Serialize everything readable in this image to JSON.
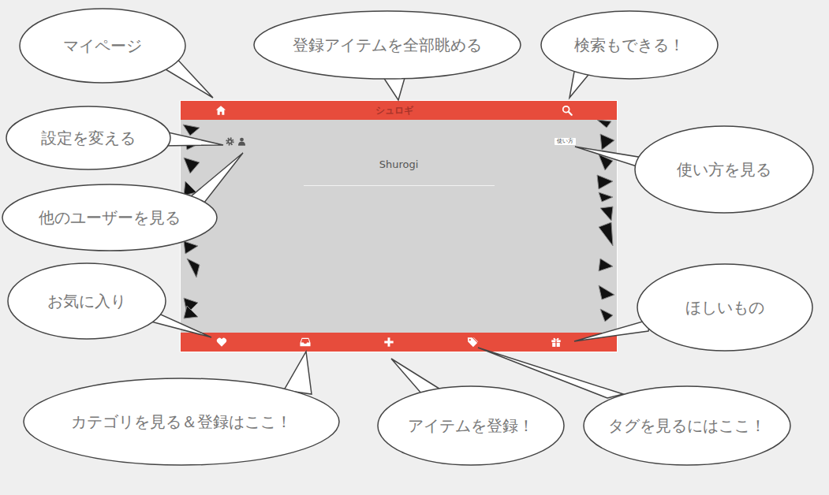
{
  "app": {
    "title": "シュロギ",
    "logo_text": "Shurogi",
    "help_button": "使い方"
  },
  "callouts": [
    {
      "text": "マイページ"
    },
    {
      "text": "登録アイテムを全部眺める"
    },
    {
      "text": "検索もできる！"
    },
    {
      "text": "設定を変える"
    },
    {
      "text": "他のユーザーを見る"
    },
    {
      "text": "使い方を見る"
    },
    {
      "text": "お気に入り"
    },
    {
      "text": "ほしいもの"
    },
    {
      "text": "カテゴリを見る＆登録はここ！"
    },
    {
      "text": "アイテムを登録！"
    },
    {
      "text": "タグを見るにはここ！"
    }
  ]
}
